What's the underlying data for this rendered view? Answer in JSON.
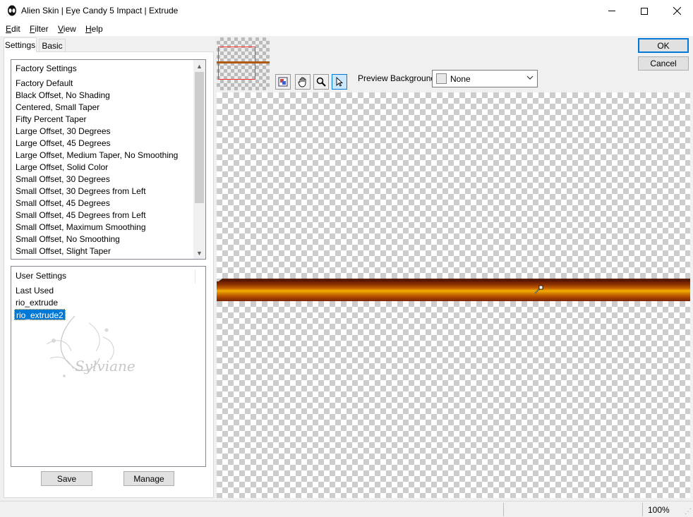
{
  "window": {
    "title": "Alien Skin | Eye Candy 5 Impact | Extrude"
  },
  "menu": [
    {
      "label": "Edit",
      "accel": "E",
      "rest": "dit"
    },
    {
      "label": "Filter",
      "accel": "F",
      "rest": "ilter"
    },
    {
      "label": "View",
      "accel": "V",
      "rest": "iew"
    },
    {
      "label": "Help",
      "accel": "H",
      "rest": "elp"
    }
  ],
  "tabs": {
    "settings": "Settings",
    "basic": "Basic"
  },
  "factory": {
    "header": "Factory Settings",
    "items": [
      "Factory Default",
      "Black Offset, No Shading",
      "Centered, Small Taper",
      "Fifty Percent Taper",
      "Large Offset, 30 Degrees",
      "Large Offset, 45 Degrees",
      "Large Offset, Medium Taper, No Smoothing",
      "Large Offset, Solid Color",
      "Small Offset, 30 Degrees",
      "Small Offset, 30 Degrees from Left",
      "Small Offset, 45 Degrees",
      "Small Offset, 45 Degrees from Left",
      "Small Offset, Maximum Smoothing",
      "Small Offset, No Smoothing",
      "Small Offset, Slight Taper"
    ]
  },
  "user": {
    "header": "User Settings",
    "items": [
      "Last Used",
      "rio_extrude",
      "rio_extrude2"
    ],
    "selected": "rio_extrude2",
    "watermark": "Sylviane"
  },
  "buttons": {
    "save": "Save",
    "manage": "Manage",
    "ok": "OK",
    "cancel": "Cancel"
  },
  "preview": {
    "background_label": "Preview Background:",
    "background_value": "None"
  },
  "status": {
    "zoom": "100%"
  },
  "colors": {
    "accent": "#0078d7",
    "extrude_light": "#f2b000",
    "extrude_dark": "#6a1e00"
  }
}
